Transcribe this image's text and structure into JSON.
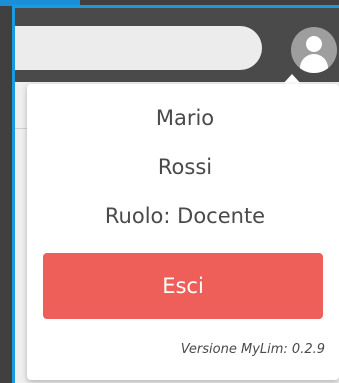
{
  "user_menu": {
    "first_name": "Mario",
    "last_name": "Rossi",
    "role": "Ruolo: Docente",
    "logout_label": "Esci",
    "version": "Versione MyLim: 0.2.9",
    "avatar_icon": "user-avatar-icon"
  },
  "colors": {
    "accent": "#1a9be0",
    "logout_button": "#ef5f5a",
    "topbar": "#4a4a4a",
    "avatar": "#9e9e9e"
  }
}
